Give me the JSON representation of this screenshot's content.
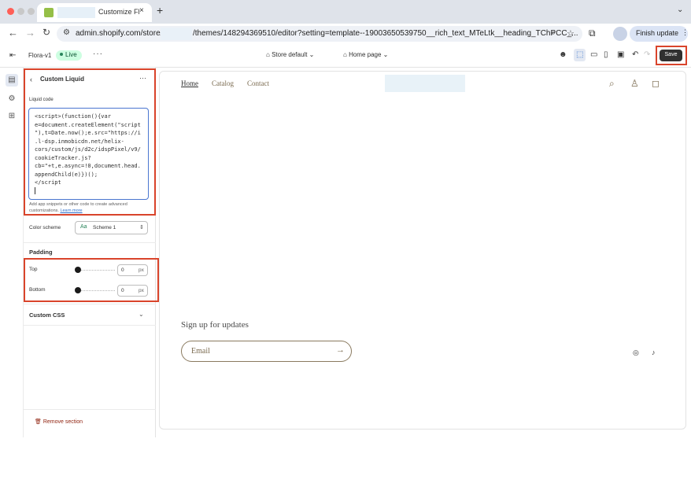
{
  "browser": {
    "tab_title": "Customize Fl",
    "tab_close": "×",
    "new_tab": "+",
    "tab_menu": "⌄",
    "url_host": "admin.shopify.com/store/",
    "url_path": "/themes/148294369510/editor?setting=template--19003650539750__rich_text_MTeLtk__heading_TChPCC_...",
    "finish_update": "Finish update"
  },
  "topbar": {
    "theme_name": "Flora-v1",
    "live_badge": "Live",
    "more": "···",
    "store_selector": "Store default",
    "page_selector": "Home page",
    "save_label": "Save"
  },
  "sidebar": {
    "title": "Custom Liquid",
    "more": "···",
    "liquid_code_label": "Liquid code",
    "liquid_code": "<script>(function(){var\ne=document.createElement(\"script\n\"),t=Date.now();e.src=\"https://i\n.l-dsp.inmobicdn.net/helix-\ncors/custom/js/d2c/idspPixel/v9/\ncookieTracker.js?\ncb=\"+t,e.async=!0,document.head.\nappendChild(e)})();\n</script",
    "help_text": "Add app snippets or other code to create advanced customizations.",
    "help_link": "Learn more",
    "color_scheme_label": "Color scheme",
    "color_scheme_value": "Scheme 1",
    "padding_title": "Padding",
    "padding_top_label": "Top",
    "padding_top_value": "0",
    "padding_bottom_label": "Bottom",
    "padding_bottom_value": "0",
    "padding_unit": "px",
    "custom_css_title": "Custom CSS",
    "remove_section": "Remove section"
  },
  "preview": {
    "nav": [
      "Home",
      "Catalog",
      "Contact"
    ],
    "signup_heading": "Sign up for updates",
    "email_placeholder": "Email"
  },
  "colors": {
    "highlight": "#d9442b",
    "live_badge_bg": "#cdfee1",
    "save_bg": "#303030",
    "focus_border": "#4a76d0"
  }
}
